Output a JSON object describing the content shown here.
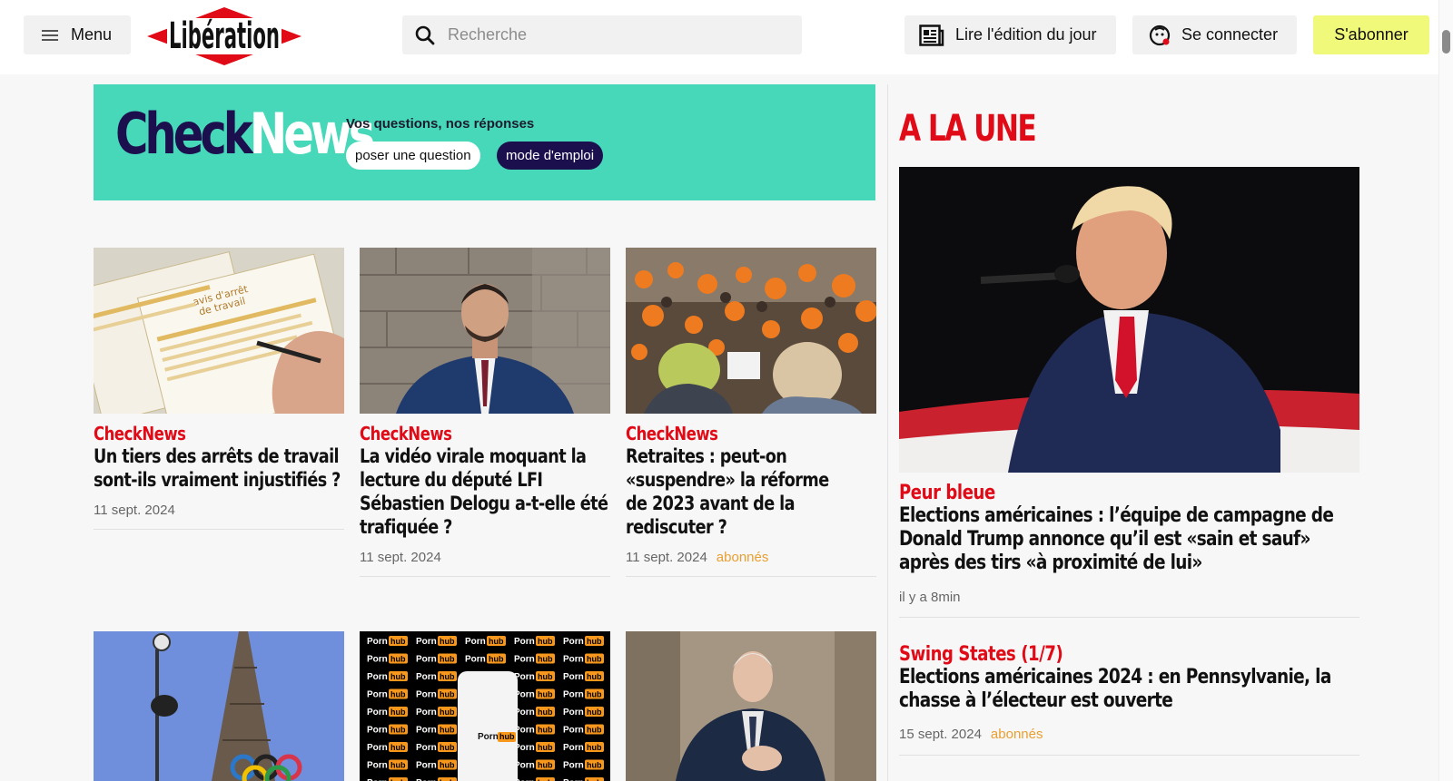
{
  "header": {
    "menu_label": "Menu",
    "logo_text": "Libération",
    "search_placeholder": "Recherche",
    "edition_label": "Lire l'édition du jour",
    "login_label": "Se connecter",
    "subscribe_label": "S'abonner",
    "icons": [
      "hamburger-icon",
      "search-icon",
      "newspaper-icon",
      "user-icon"
    ]
  },
  "banner": {
    "logo_check": "Check",
    "logo_news": "News",
    "tagline": "Vos questions, nos réponses",
    "ask_label": "poser une question",
    "mode_label": "mode d'emploi",
    "colors": {
      "background": "#47d7b9",
      "dark": "#1c0f4e"
    }
  },
  "articles": [
    {
      "kicker": "CheckNews",
      "title": "Un tiers des arrêts de travail sont-ils vraiment injustifiés ?",
      "date": "11 sept. 2024",
      "badge": ""
    },
    {
      "kicker": "CheckNews",
      "title": "La vidéo virale moquant la lecture du député LFI Sébastien Delogu a-t-elle été trafiquée ?",
      "date": "11 sept. 2024",
      "badge": ""
    },
    {
      "kicker": "CheckNews",
      "title": "Retraites : peut-on «suspendre» la réforme de 2023 avant de la rediscuter ?",
      "date": "11 sept. 2024",
      "badge": "abonnés"
    }
  ],
  "une": {
    "title": "A LA UNE",
    "lead": {
      "kicker": "Peur bleue",
      "title": "Elections américaines : l’équipe de campagne de Donald Trump annonce qu’il est «sain et sauf» après des tirs «à proximité de lui»",
      "time": "il y a 8min"
    },
    "second": {
      "kicker": "Swing States (1/7)",
      "title": "Elections américaines 2024 : en Pennsylvanie, la chasse à l’électeur est ouverte",
      "date": "15 sept. 2024",
      "badge": "abonnés"
    }
  },
  "thumb_texts": {
    "brand_a": "Porn",
    "brand_b": "hub",
    "form_title": "avis d'arrêt",
    "form_sub": "de travail"
  },
  "colors": {
    "accent": "#e10a17",
    "subscribe": "#f0f97a",
    "badge": "#e8a032"
  }
}
